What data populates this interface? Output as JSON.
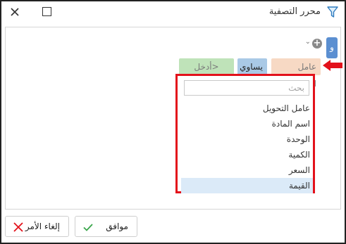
{
  "window": {
    "title": "محرر التصفية"
  },
  "filter": {
    "group_operator": "و",
    "condition": {
      "field": "عامل التحويل",
      "operator": "يساوي",
      "value_placeholder": "<أدخل قيمة>"
    }
  },
  "dropdown": {
    "search_placeholder": "بحث",
    "items": [
      {
        "label": "عامل التحويل",
        "selected": false
      },
      {
        "label": "اسم المادة",
        "selected": false
      },
      {
        "label": "الوحدة",
        "selected": false
      },
      {
        "label": "الكمية",
        "selected": false
      },
      {
        "label": "السعر",
        "selected": false
      },
      {
        "label": "القيمة",
        "selected": true
      }
    ]
  },
  "footer": {
    "ok_label": "موافق",
    "cancel_label": "إلغاء الأمر"
  },
  "colors": {
    "highlight_border": "#e3111b",
    "group_button": "#5b8fd1",
    "field_chip": "#f7d9c4",
    "operator_chip": "#a9c9e6",
    "value_chip": "#bfe3b9",
    "selected_item": "#dbeaf8",
    "ok_check": "#3aa64b",
    "cancel_x": "#e3111b"
  }
}
